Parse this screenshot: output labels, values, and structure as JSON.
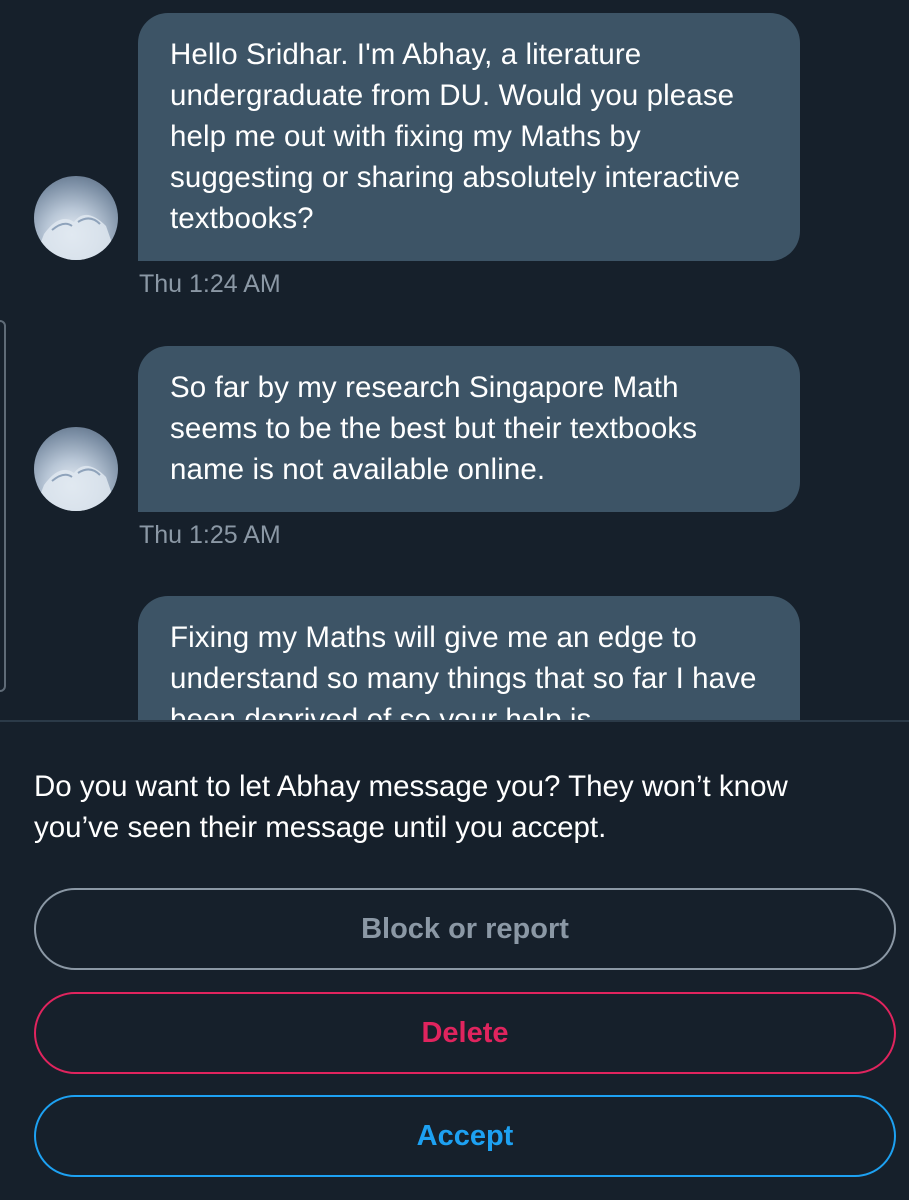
{
  "conversation": {
    "messages": [
      {
        "text": "Hello Sridhar. I'm Abhay, a literature undergraduate from DU. Would you please help me out with fixing my Maths by suggesting or sharing absolutely interactive  textbooks?",
        "timestamp": "Thu 1:24 AM"
      },
      {
        "text": "So far by my research Singapore Math seems to be the best but their textbooks name is not available online.",
        "timestamp": "Thu 1:25 AM"
      },
      {
        "text": "Fixing my Maths will give me an edge to understand so many things that so far I have been deprived of so your help is",
        "timestamp": ""
      }
    ]
  },
  "request": {
    "prompt": "Do you want to let Abhay message you? They won’t know you’ve seen their message until you accept.",
    "block_label": "Block or report",
    "delete_label": "Delete",
    "accept_label": "Accept"
  },
  "colors": {
    "background": "#16202b",
    "bubble": "#3d5466",
    "muted": "#8b98a5",
    "danger": "#e0245e",
    "accent": "#1da1f2"
  }
}
